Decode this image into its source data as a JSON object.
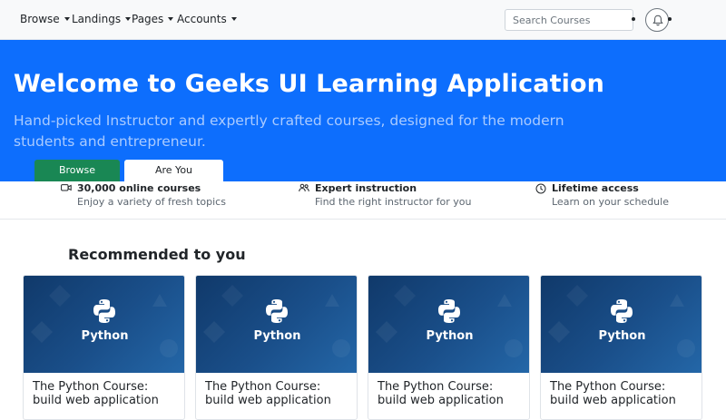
{
  "nav": {
    "items": [
      {
        "label": "Browse"
      },
      {
        "label": "Landings"
      },
      {
        "label": "Pages"
      },
      {
        "label": "Accounts"
      }
    ],
    "search": {
      "placeholder": "Search Courses",
      "icon": "search-icon"
    },
    "notifications": {
      "icon": "bell-icon"
    }
  },
  "hero": {
    "title": "Welcome to Geeks UI Learning Application",
    "subtitle": "Hand-picked Instructor and expertly crafted courses, designed for the modern students and entrepreneur.",
    "primary_button": "Browse Courses",
    "secondary_button": "Are You Instructor?",
    "background_color": "#0d6efd"
  },
  "features": [
    {
      "icon": "video-icon",
      "title": "30,000 online courses",
      "text": "Enjoy a variety of fresh topics"
    },
    {
      "icon": "users-icon",
      "title": "Expert instruction",
      "text": "Find the right instructor for you"
    },
    {
      "icon": "clock-icon",
      "title": "Lifetime access",
      "text": "Learn on your schedule"
    }
  ],
  "recommended": {
    "title": "Recommended to you",
    "cards": [
      {
        "image_label": "Python",
        "title": "The Python Course: build web application"
      },
      {
        "image_label": "Python",
        "title": "The Python Course: build web application"
      },
      {
        "image_label": "Python",
        "title": "The Python Course: build web application"
      },
      {
        "image_label": "Python",
        "title": "The Python Course: build web application"
      }
    ]
  }
}
